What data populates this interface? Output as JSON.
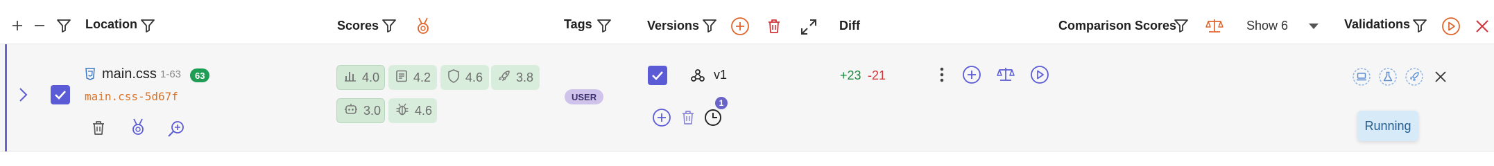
{
  "header": {
    "location_label": "Location",
    "scores_label": "Scores",
    "tags_label": "Tags",
    "versions_label": "Versions",
    "diff_label": "Diff",
    "comparison_label": "Comparison Scores",
    "show_count_label": "Show 6",
    "validations_label": "Validations"
  },
  "row": {
    "file": {
      "name": "main.css",
      "range": "1-63",
      "lines_badge": "63",
      "hash": "main.css-5d67f"
    },
    "scores": [
      {
        "icon": "bar-chart-icon",
        "value": "4.0"
      },
      {
        "icon": "document-icon",
        "value": "4.2"
      },
      {
        "icon": "shield-icon",
        "value": "4.6"
      },
      {
        "icon": "rocket-icon",
        "value": "3.8"
      },
      {
        "icon": "robot-icon",
        "value": "3.0"
      },
      {
        "icon": "bug-icon",
        "value": "4.6"
      }
    ],
    "tag": "USER",
    "version": {
      "label": "v1",
      "history_count": "1"
    },
    "diff": {
      "added": "+23",
      "removed": "-21"
    },
    "validation_status": "Running"
  },
  "colors": {
    "accent": "#5b5bd6",
    "danger": "#d1343a",
    "chip_bg": "#d8eddb",
    "tag_bg": "#cfc3ec",
    "status_bg": "#d6eaf8",
    "lines_badge_bg": "#1f9d55",
    "hash_text": "#d9742b"
  }
}
